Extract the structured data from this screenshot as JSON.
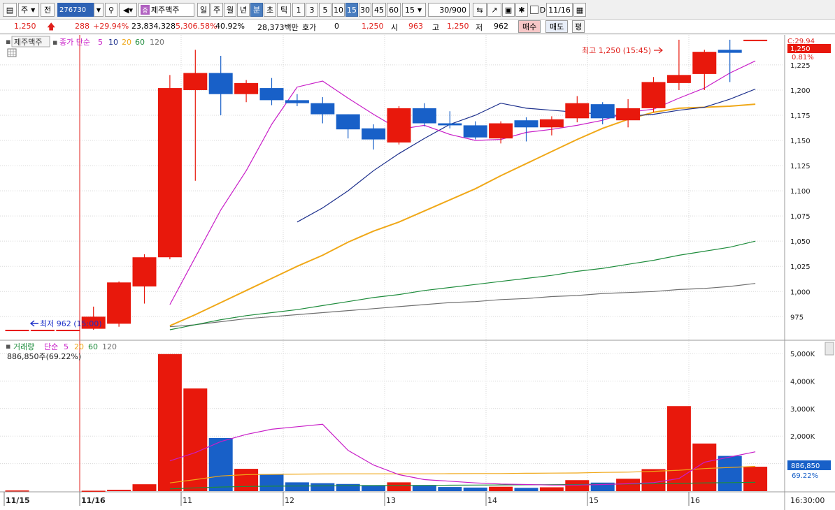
{
  "toolbar": {
    "code": "276730",
    "name": "제주맥주",
    "name_tag": "증",
    "jeon_label": "전",
    "ju_label": "주",
    "periods": [
      "일",
      "주",
      "월",
      "년",
      "분",
      "초",
      "틱"
    ],
    "intervals": [
      "1",
      "3",
      "5",
      "10",
      "15",
      "30",
      "45",
      "60"
    ],
    "interval_select": "15",
    "page_info": "30/900",
    "d_label": "D",
    "date": "11/16"
  },
  "quote": {
    "price": "1,250",
    "change": "288",
    "change_pct": "+29.94%",
    "volume": "23,834,328",
    "volume_pct": "5,306.58%",
    "turnover_pct": "40.92%",
    "amount": "28,373백만",
    "hoga_label": "호가",
    "hoga_value": "0",
    "bid_price": "1,250",
    "open_label": "시",
    "open": "963",
    "high_label": "고",
    "high": "1,250",
    "low_label": "저",
    "low": "962",
    "buy_label": "매수",
    "sell_label": "매도",
    "eval_label": "평"
  },
  "price_panel": {
    "stock_label": "제주맥주",
    "legend_prefix": "종가 단순",
    "ma_periods": [
      "5",
      "10",
      "20",
      "60",
      "120"
    ],
    "high_annotation": "최고 1,250 (15:45)",
    "low_annotation": "최저 962 (15:00)",
    "right_info": "C:29.94",
    "current_price": "1,250",
    "current_pct": "0.81%"
  },
  "volume_panel": {
    "title": "거래량",
    "legend_prefix": "단순",
    "ma_periods": [
      "5",
      "20",
      "60",
      "120"
    ],
    "last_value_text": "886,850주(69.22%)",
    "current_value": "886,850",
    "current_pct": "69.22%"
  },
  "colors": {
    "up": "#e8180c",
    "down": "#1860c8",
    "ma5": "#c81ec8",
    "ma10": "#1c2f8c",
    "ma20": "#f0a818",
    "ma60": "#1e8c3c",
    "ma120": "#707070",
    "grid": "#d8d8d8"
  },
  "chart_data": {
    "type": "candlestick",
    "interval_minutes": 15,
    "y_ticks": [
      975,
      1000,
      1025,
      1050,
      1075,
      1100,
      1125,
      1150,
      1175,
      1200,
      1225
    ],
    "ylim": [
      953,
      1252
    ],
    "volume_ticks": [
      "1,000K",
      "2,000K",
      "3,000K",
      "4,000K",
      "5,000K"
    ],
    "volume_ylim": [
      0,
      5000
    ],
    "x_labels": [
      "11/15",
      "11/16",
      "11",
      "12",
      "13",
      "14",
      "15",
      "16"
    ],
    "time_label": "16:30:00",
    "candles": [
      {
        "o": 962,
        "h": 962,
        "l": 962,
        "c": 962,
        "vol": 25
      },
      {
        "o": 962,
        "h": 962,
        "l": 962,
        "c": 962,
        "vol": 0
      },
      {
        "o": 962,
        "h": 962,
        "l": 962,
        "c": 962,
        "vol": 0
      },
      {
        "o": 963,
        "h": 985,
        "l": 962,
        "c": 975,
        "vol": 15
      },
      {
        "o": 968,
        "h": 1010,
        "l": 965,
        "c": 1009,
        "vol": 50
      },
      {
        "o": 1005,
        "h": 1037,
        "l": 988,
        "c": 1034,
        "vol": 250
      },
      {
        "o": 1034,
        "h": 1215,
        "l": 1032,
        "c": 1202,
        "vol": 4980
      },
      {
        "o": 1200,
        "h": 1240,
        "l": 1110,
        "c": 1217,
        "vol": 3730
      },
      {
        "o": 1217,
        "h": 1234,
        "l": 1175,
        "c": 1196,
        "vol": 1930
      },
      {
        "o": 1196,
        "h": 1210,
        "l": 1188,
        "c": 1207,
        "vol": 810
      },
      {
        "o": 1202,
        "h": 1212,
        "l": 1185,
        "c": 1190,
        "vol": 620
      },
      {
        "o": 1190,
        "h": 1196,
        "l": 1184,
        "c": 1187,
        "vol": 320
      },
      {
        "o": 1187,
        "h": 1193,
        "l": 1167,
        "c": 1176,
        "vol": 290
      },
      {
        "o": 1176,
        "h": 1176,
        "l": 1152,
        "c": 1161,
        "vol": 260
      },
      {
        "o": 1162,
        "h": 1166,
        "l": 1141,
        "c": 1151,
        "vol": 220
      },
      {
        "o": 1148,
        "h": 1184,
        "l": 1146,
        "c": 1182,
        "vol": 320
      },
      {
        "o": 1182,
        "h": 1187,
        "l": 1164,
        "c": 1167,
        "vol": 200
      },
      {
        "o": 1167,
        "h": 1179,
        "l": 1162,
        "c": 1165,
        "vol": 150
      },
      {
        "o": 1165,
        "h": 1169,
        "l": 1151,
        "c": 1153,
        "vol": 130
      },
      {
        "o": 1152,
        "h": 1169,
        "l": 1147,
        "c": 1167,
        "vol": 160
      },
      {
        "o": 1170,
        "h": 1173,
        "l": 1149,
        "c": 1163,
        "vol": 120
      },
      {
        "o": 1163,
        "h": 1174,
        "l": 1155,
        "c": 1171,
        "vol": 140
      },
      {
        "o": 1172,
        "h": 1194,
        "l": 1168,
        "c": 1187,
        "vol": 400
      },
      {
        "o": 1186,
        "h": 1188,
        "l": 1166,
        "c": 1172,
        "vol": 310
      },
      {
        "o": 1170,
        "h": 1191,
        "l": 1163,
        "c": 1182,
        "vol": 450
      },
      {
        "o": 1182,
        "h": 1213,
        "l": 1178,
        "c": 1208,
        "vol": 800
      },
      {
        "o": 1207,
        "h": 1250,
        "l": 1200,
        "c": 1215,
        "vol": 3090
      },
      {
        "o": 1216,
        "h": 1240,
        "l": 1200,
        "c": 1238,
        "vol": 1730
      },
      {
        "o": 1240,
        "h": 1250,
        "l": 1208,
        "c": 1237,
        "vol": 1280
      },
      {
        "o": 1250,
        "h": 1250,
        "l": 1250,
        "c": 1250,
        "vol": 887
      }
    ],
    "ma5": [
      null,
      null,
      null,
      null,
      null,
      null,
      987,
      1034,
      1081,
      1120,
      1166,
      1203,
      1209,
      1192,
      1176,
      1161,
      1165,
      1156,
      1150,
      1151,
      1158,
      1161,
      1165,
      1170,
      1178,
      1181,
      1192,
      1202,
      1217,
      1229
    ],
    "ma10": [
      null,
      null,
      null,
      null,
      null,
      null,
      null,
      null,
      null,
      null,
      null,
      1069,
      1083,
      1100,
      1120,
      1137,
      1152,
      1166,
      1175,
      1187,
      1182,
      1180,
      1178,
      1176,
      1174,
      1176,
      1180,
      1183,
      1191,
      1201
    ],
    "ma20": [
      null,
      null,
      null,
      null,
      null,
      null,
      966,
      977,
      989,
      1001,
      1013,
      1025,
      1036,
      1049,
      1060,
      1069,
      1080,
      1091,
      1102,
      1115,
      1127,
      1139,
      1151,
      1162,
      1171,
      1178,
      1182,
      1183,
      1184,
      1186
    ],
    "ma60": [
      null,
      null,
      null,
      null,
      null,
      null,
      962,
      967,
      972,
      976,
      979,
      982,
      986,
      990,
      994,
      997,
      1001,
      1004,
      1007,
      1010,
      1013,
      1016,
      1020,
      1023,
      1027,
      1031,
      1036,
      1040,
      1044,
      1050
    ],
    "ma120": [
      null,
      null,
      null,
      null,
      null,
      null,
      965,
      967,
      970,
      973,
      975,
      977,
      979,
      981,
      983,
      985,
      987,
      989,
      990,
      992,
      993,
      995,
      996,
      998,
      999,
      1000,
      1002,
      1003,
      1005,
      1008
    ],
    "vol_ma5": [
      null,
      null,
      null,
      null,
      null,
      null,
      1100,
      1400,
      1800,
      2060,
      2250,
      2340,
      2430,
      1480,
      950,
      600,
      420,
      360,
      300,
      260,
      240,
      220,
      220,
      240,
      270,
      310,
      460,
      1050,
      1240,
      1430
    ],
    "vol_ma20": [
      null,
      null,
      null,
      null,
      null,
      null,
      300,
      420,
      550,
      600,
      610,
      620,
      625,
      630,
      630,
      630,
      630,
      635,
      640,
      640,
      650,
      655,
      660,
      680,
      690,
      720,
      760,
      820,
      860,
      900
    ],
    "vol_ma60": [
      null,
      null,
      null,
      null,
      null,
      null,
      80,
      120,
      150,
      170,
      180,
      185,
      190,
      195,
      200,
      205,
      210,
      215,
      220,
      225,
      230,
      235,
      240,
      250,
      260,
      270,
      280,
      300,
      310,
      320
    ]
  }
}
